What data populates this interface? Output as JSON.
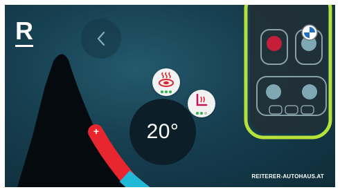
{
  "brand": {
    "logo_letter": "R",
    "watermark": "REITERER-AUTOHAUS.AT"
  },
  "navigation": {
    "back_icon": "chevron-left-icon"
  },
  "climate": {
    "temperature": "20°",
    "slider_plus": "+",
    "slider_color_hot": "#e8262f",
    "slider_color_cold": "#22b8d8"
  },
  "seat_controls": [
    {
      "name": "seat-heating",
      "icon": "seat-heating-icon",
      "level": 3,
      "max_level": 3,
      "color": "#d7262e"
    },
    {
      "name": "lumbar-support",
      "icon": "lumbar-seat-icon",
      "level": 2,
      "max_level": 3,
      "color": "#c2185b"
    }
  ],
  "car_overview": {
    "badge_icon": "bmw-roundel-icon",
    "outline_color": "#b6e13a"
  },
  "colors": {
    "background": "#163f50",
    "knob": "#0c1f28",
    "accent_green": "#2db34a"
  }
}
